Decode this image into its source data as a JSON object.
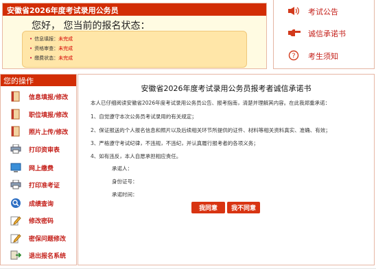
{
  "status": {
    "title": "安徽省2026年度考试录用公务员",
    "greeting": "您好， 您当前的报名状态：",
    "rows": [
      {
        "label": "信息填报：",
        "value": "未完成"
      },
      {
        "label": "资格审查：",
        "value": "未完成"
      },
      {
        "label": "缴费状态：",
        "value": "未完成"
      }
    ]
  },
  "links": [
    {
      "label": "考试公告",
      "icon": "speaker-icon"
    },
    {
      "label": "诚信承诺书",
      "icon": "pointing-hand-icon"
    },
    {
      "label": "考生须知",
      "icon": "question-circle-icon"
    }
  ],
  "sidebar": {
    "title": "您的操作",
    "items": [
      {
        "label": "信息填报/修改",
        "icon": "book-icon"
      },
      {
        "label": "职位填报/修改",
        "icon": "book-icon"
      },
      {
        "label": "照片上传/修改",
        "icon": "book-icon"
      },
      {
        "label": "打印资审表",
        "icon": "printer-icon"
      },
      {
        "label": "网上缴费",
        "icon": "monitor-icon"
      },
      {
        "label": "打印准考证",
        "icon": "printer-icon"
      },
      {
        "label": "成绩查询",
        "icon": "search-icon"
      },
      {
        "label": "修改密码",
        "icon": "pencil-icon"
      },
      {
        "label": "密保问题修改",
        "icon": "pencil-icon"
      },
      {
        "label": "退出报名系统",
        "icon": "exit-icon"
      }
    ]
  },
  "main": {
    "title": "安徽省2026年度考试录用公务员报考者诚信承诺书",
    "intro": "本人已仔细阅读安徽省2026年度考试录用公务员公告、报考指南，清楚并理解其内容。在此我郑重承诺：",
    "items": [
      "1、自觉遵守本次公务员考试录用的有关规定；",
      "2、保证报送的个人报名信息和照片以及后续相关环节所提供的证件、材料等相关资料真实、准确、有效；",
      "3、严格遵守考试纪律，不违规，不违纪，并认真履行报考者的各项义务；",
      "4、如有违反，本人自愿承担相应责任。"
    ],
    "signature": [
      "承诺人：",
      "身份证号：",
      "承诺时间："
    ],
    "agree_label": "我同意",
    "disagree_label": "我不同意"
  }
}
